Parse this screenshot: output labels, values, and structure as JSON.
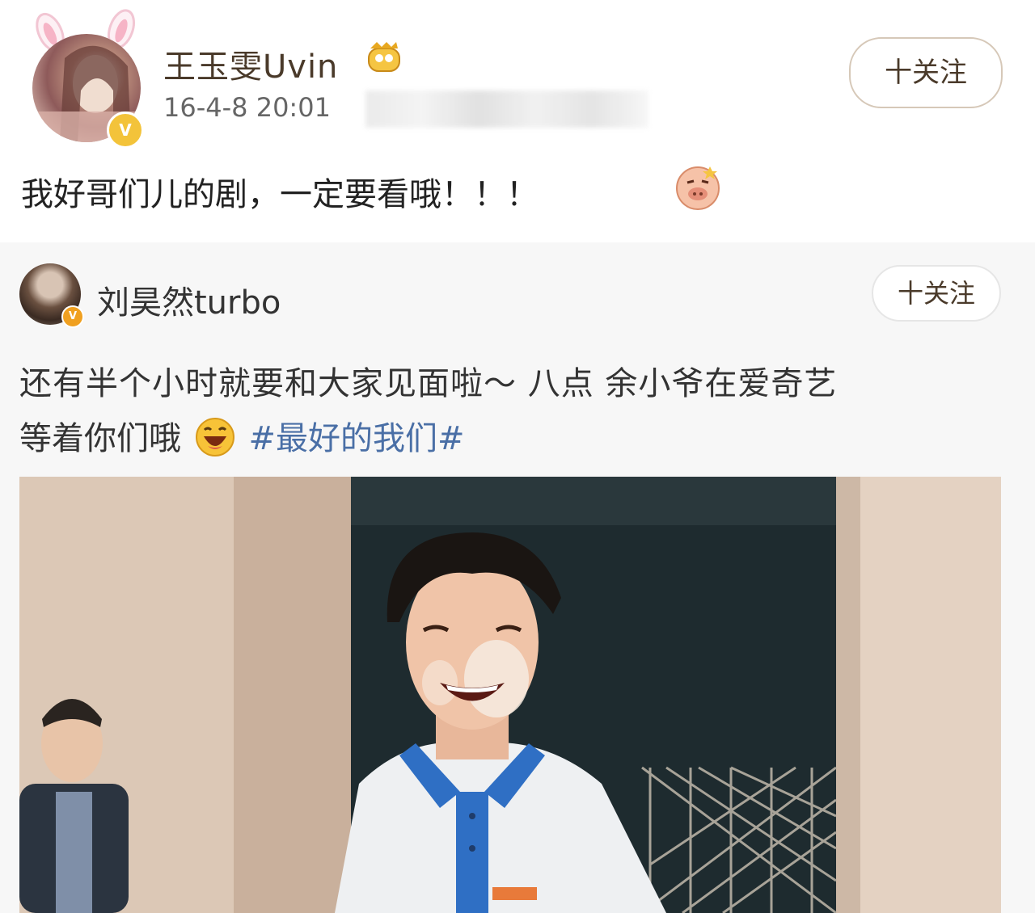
{
  "post": {
    "username": "王玉雯Uvin",
    "timestamp": "16-4-8 20:01",
    "follow_label": "十关注",
    "text": "我好哥们儿的剧，一定要看哦！！！",
    "verified_badge": "V"
  },
  "repost": {
    "username": "刘昊然turbo",
    "follow_label": "十关注",
    "verified_badge": "V",
    "line1": "还有半个小时就要和大家见面啦～  八点 余小爷在爱奇艺",
    "line2_prefix": "等着你们哦",
    "hashtag": "#最好的我们#"
  },
  "colors": {
    "hashtag": "#4a6fa6",
    "verified_gold": "#f3c33a",
    "shirt_blue": "#2f6fc4"
  },
  "icons": [
    "bunny-ears-icon",
    "crown-icon",
    "verified-icon",
    "pig-emoji-icon",
    "laughing-emoji-icon"
  ]
}
